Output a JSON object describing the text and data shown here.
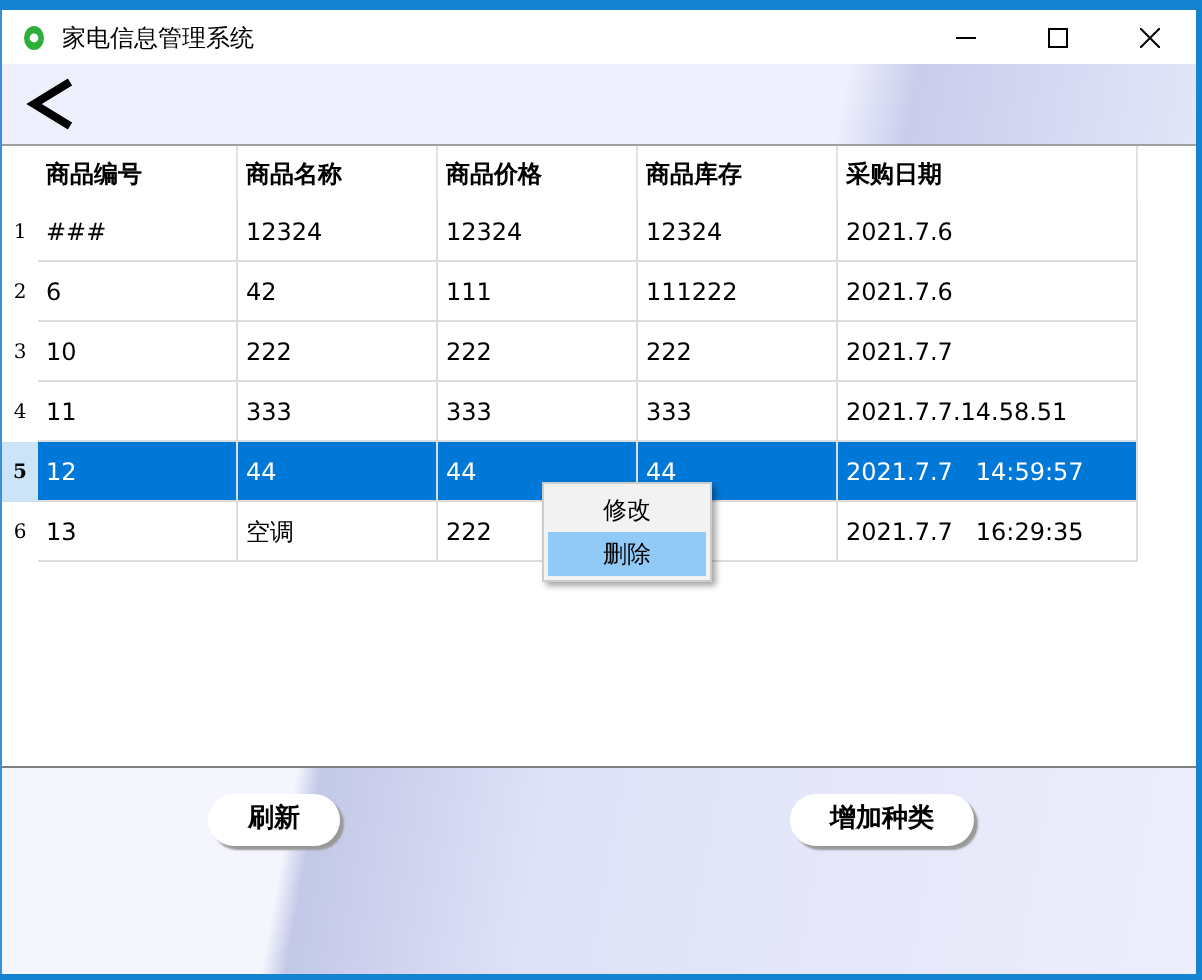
{
  "window": {
    "title": "家电信息管理系统"
  },
  "table": {
    "columns": [
      "商品编号",
      "商品名称",
      "商品价格",
      "商品库存",
      "采购日期"
    ],
    "rows": [
      {
        "number": "1",
        "selected": false,
        "cells": [
          "###",
          "12324",
          "12324",
          "12324",
          "2021.7.6"
        ]
      },
      {
        "number": "2",
        "selected": false,
        "cells": [
          "6",
          "42",
          "111",
          "111222",
          "2021.7.6"
        ]
      },
      {
        "number": "3",
        "selected": false,
        "cells": [
          "10",
          "222",
          "222",
          "222",
          "2021.7.7"
        ]
      },
      {
        "number": "4",
        "selected": false,
        "cells": [
          "11",
          "333",
          "333",
          "333",
          "2021.7.7.14.58.51"
        ]
      },
      {
        "number": "5",
        "selected": true,
        "cells": [
          "12",
          "44",
          "44",
          "44",
          "2021.7.7   14:59:57"
        ]
      },
      {
        "number": "6",
        "selected": false,
        "cells": [
          "13",
          "空调",
          "222",
          "",
          "2021.7.7   16:29:35"
        ]
      }
    ]
  },
  "context_menu": {
    "items": [
      {
        "label": "修改",
        "selected": false
      },
      {
        "label": "删除",
        "selected": true
      }
    ]
  },
  "buttons": [
    "刷新",
    "增加种类"
  ]
}
